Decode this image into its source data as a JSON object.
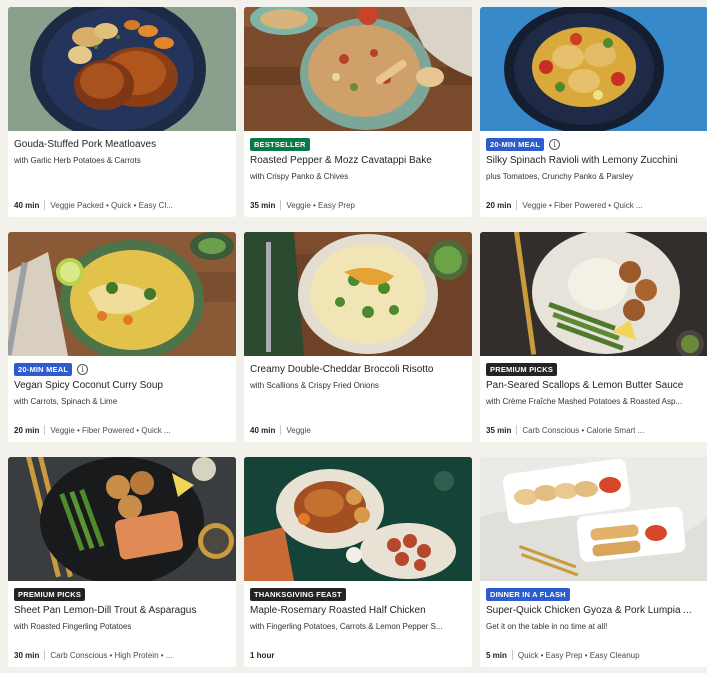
{
  "recipes": [
    {
      "badge": "",
      "title": "Gouda-Stuffed Pork Meatloaves",
      "subtitle": "with Garlic Herb Potatoes & Carrots",
      "time": "40 min",
      "tags": "Veggie Packed • Quick • Easy Cl..."
    },
    {
      "badge": "BESTSELLER",
      "badge_color": "#067a46",
      "title": "Roasted Pepper & Mozz Cavatappi Bake",
      "subtitle": "with Crispy Panko & Chives",
      "time": "35 min",
      "tags": "Veggie • Easy Prep"
    },
    {
      "badge": "20-MIN MEAL",
      "badge_color": "#2d5ccf",
      "info": "i",
      "title": "Silky Spinach Ravioli with Lemony Zucchini",
      "subtitle": "plus Tomatoes, Crunchy Panko & Parsley",
      "time": "20 min",
      "tags": "Veggie • Fiber Powered • Quick ..."
    },
    {
      "badge": "20-MIN MEAL",
      "badge_color": "#2d5ccf",
      "info": "i",
      "title": "Vegan Spicy Coconut Curry Soup",
      "subtitle": "with Carrots, Spinach & Lime",
      "time": "20 min",
      "tags": "Veggie • Fiber Powered • Quick ..."
    },
    {
      "badge": "",
      "title": "Creamy Double-Cheddar Broccoli Risotto",
      "subtitle": "with Scallions & Crispy Fried Onions",
      "time": "40 min",
      "tags": "Veggie"
    },
    {
      "badge": "PREMIUM PICKS",
      "badge_color": "#242424",
      "title": "Pan-Seared Scallops & Lemon Butter Sauce",
      "subtitle": "with Crème Fraîche Mashed Potatoes & Roasted Asp...",
      "time": "35 min",
      "tags": "Carb Conscious • Calorie Smart ..."
    },
    {
      "badge": "PREMIUM PICKS",
      "badge_color": "#242424",
      "title": "Sheet Pan Lemon-Dill Trout & Asparagus",
      "subtitle": "with Roasted Fingerling Potatoes",
      "time": "30 min",
      "tags": "Carb Conscious • High Protein • ..."
    },
    {
      "badge": "THANKSGIVING FEAST",
      "badge_color": "#242424",
      "title": "Maple-Rosemary Roasted Half Chicken",
      "subtitle": "with Fingerling Potatoes, Carrots & Lemon Pepper S...",
      "time": "1 hour",
      "tags": ""
    },
    {
      "badge": "DINNER IN A FLASH",
      "badge_color": "#2d5ccf",
      "title": "Super-Quick Chicken Gyoza & Pork Lumpia ...",
      "subtitle": "Get it on the table in no time at all!",
      "time": "5 min",
      "tags": "Quick • Easy Prep • Easy Cleanup"
    }
  ]
}
